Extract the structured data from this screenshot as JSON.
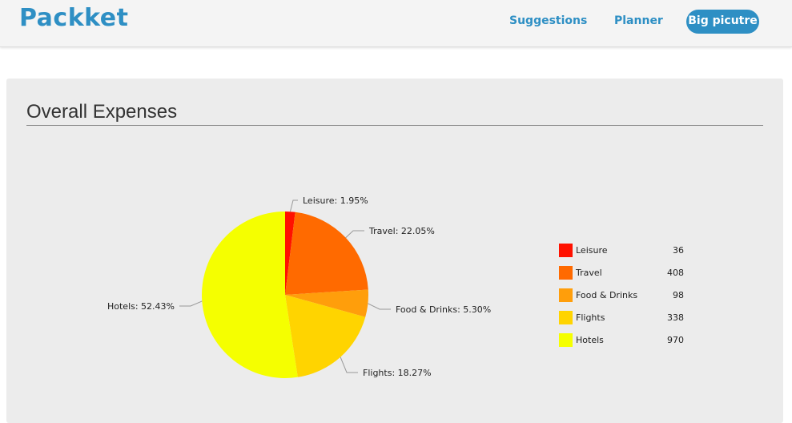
{
  "header": {
    "logo": "Packket",
    "nav": {
      "suggestions": "Suggestions",
      "planner": "Planner",
      "big_picture": "Big picutre"
    }
  },
  "main": {
    "title": "Overall Expenses"
  },
  "colors": {
    "brand": "#2e8fc4",
    "leisure": "#ff1100",
    "travel": "#ff6a00",
    "food_drinks": "#ff9e0b",
    "flights": "#ffd400",
    "hotels": "#f5ff00"
  },
  "chart_data": {
    "type": "pie",
    "title": "",
    "categories": [
      "Leisure",
      "Travel",
      "Food & Drinks",
      "Flights",
      "Hotels"
    ],
    "values": [
      36,
      408,
      98,
      338,
      970
    ],
    "slice_labels": [
      "Leisure: 1.95%",
      "Travel: 22.05%",
      "Food & Drinks: 5.30%",
      "Flights: 18.27%",
      "Hotels: 52.43%"
    ],
    "colors": [
      "#ff1100",
      "#ff6a00",
      "#ff9e0b",
      "#ffd400",
      "#f5ff00"
    ],
    "legend_placement": "right"
  },
  "legend": {
    "items": [
      {
        "label": "Leisure",
        "value": "36"
      },
      {
        "label": "Travel",
        "value": "408"
      },
      {
        "label": "Food & Drinks",
        "value": "98"
      },
      {
        "label": "Flights",
        "value": "338"
      },
      {
        "label": "Hotels",
        "value": "970"
      }
    ]
  }
}
